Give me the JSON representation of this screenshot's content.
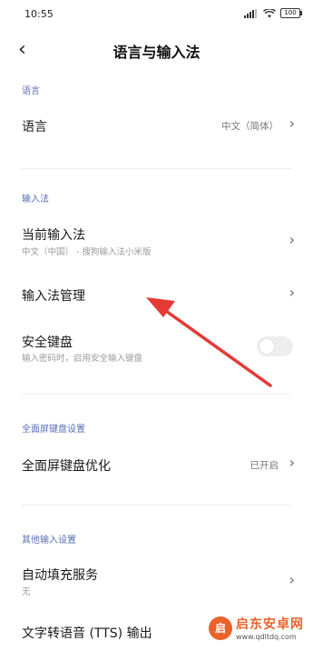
{
  "status_bar": {
    "time": "10:55",
    "battery": "100"
  },
  "header": {
    "back_icon": "chevron-left-icon",
    "title": "语言与输入法"
  },
  "sections": {
    "language": {
      "header": "语言",
      "item": {
        "label": "语言",
        "value": "中文（简体）"
      }
    },
    "input_method": {
      "header": "输入法",
      "current": {
        "label": "当前输入法",
        "sub": "中文（中国） - 搜狗输入法小米版"
      },
      "manage": {
        "label": "输入法管理"
      },
      "secure_keyboard": {
        "label": "安全键盘",
        "sub": "输入密码时，启用安全输入键盘",
        "enabled": false
      }
    },
    "fullscreen_keyboard": {
      "header": "全面屏键盘设置",
      "optimize": {
        "label": "全面屏键盘优化",
        "value": "已开启"
      }
    },
    "other_input": {
      "header": "其他输入设置",
      "autofill": {
        "label": "自动填充服务",
        "sub": "无"
      },
      "tts": {
        "label": "文字转语音 (TTS) 输出"
      }
    }
  },
  "annotation": {
    "color": "#e53935"
  },
  "watermark": {
    "name": "启东安卓网",
    "url": "www.qdltdq.com",
    "logo_glyph": "启"
  },
  "colors": {
    "section_header": "#5a6fb4",
    "accent_watermark": "#e8622a"
  }
}
